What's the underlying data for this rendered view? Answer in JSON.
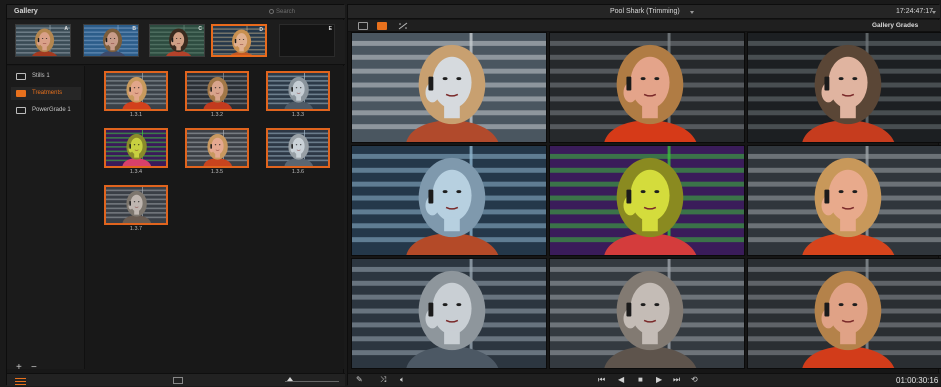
{
  "gallery": {
    "title": "Gallery",
    "search_placeholder": "Search",
    "memories": [
      {
        "letter": "A",
        "variant": 0
      },
      {
        "letter": "B",
        "variant": 1
      },
      {
        "letter": "C",
        "variant": 2
      },
      {
        "letter": "D",
        "variant": 3,
        "active": true
      },
      {
        "letter": "E",
        "empty": true
      }
    ],
    "albums": [
      {
        "label": "Stills 1",
        "icon": "stills-album-icon"
      },
      {
        "label": "Treatments",
        "icon": "treatments-album-icon",
        "selected": true
      },
      {
        "label": "PowerGrade 1",
        "icon": "powergrade-album-icon"
      }
    ],
    "stills": [
      {
        "label": "1.3.1",
        "variant": 4
      },
      {
        "label": "1.3.2",
        "variant": 5
      },
      {
        "label": "1.3.3",
        "variant": 6
      },
      {
        "label": "1.3.4",
        "variant": 7
      },
      {
        "label": "1.3.5",
        "variant": 8
      },
      {
        "label": "1.3.6",
        "variant": 9
      },
      {
        "label": "1.3.7",
        "variant": 10
      }
    ],
    "add_label": "+",
    "remove_label": "−"
  },
  "viewer": {
    "clip_title": "Pool Shark (Trimming)",
    "timecode_top": "17:24:47:17",
    "mode_label": "Gallery Grades",
    "timecode_bottom": "01:00:30:16",
    "grades": [
      {
        "variant": 11
      },
      {
        "variant": 12
      },
      {
        "variant": 13
      },
      {
        "variant": 14
      },
      {
        "variant": 15
      },
      {
        "variant": 16
      },
      {
        "variant": 17
      },
      {
        "variant": 18
      },
      {
        "variant": 19
      }
    ],
    "transport": {
      "first": "⏮",
      "prev": "◀",
      "stop": "■",
      "play": "▶",
      "last": "⏭",
      "loop": "⟲"
    }
  },
  "palettes": [
    {
      "bg": "#3a4b55",
      "stripe": "#9aa9b2",
      "skin": "#d9a088",
      "hair": "#b3864f",
      "coat": "#a33a20"
    },
    {
      "bg": "#2c5d8a",
      "stripe": "#7fa3c8",
      "skin": "#c89c8a",
      "hair": "#7a5d3c",
      "coat": "#3d4a6a"
    },
    {
      "bg": "#2d4c40",
      "stripe": "#6a8a7a",
      "skin": "#d0a085",
      "hair": "#3a2a1e",
      "coat": "#b4422a"
    },
    {
      "bg": "#26384a",
      "stripe": "#b7a789",
      "skin": "#e0b090",
      "hair": "#c89050",
      "coat": "#c45a25"
    },
    {
      "bg": "#3a4148",
      "stripe": "#9aa4ac",
      "skin": "#e2a68a",
      "hair": "#c89a5e",
      "coat": "#d2401c"
    },
    {
      "bg": "#2a2f35",
      "stripe": "#8d949a",
      "skin": "#d8a48c",
      "hair": "#a27848",
      "coat": "#c23a1e"
    },
    {
      "bg": "#2c3a48",
      "stripe": "#a4b8c6",
      "skin": "#c5cdd4",
      "hair": "#8a949c",
      "coat": "#4e5a66"
    },
    {
      "bg": "#3a1a5a",
      "stripe": "#3ec83e",
      "skin": "#c8d040",
      "hair": "#8a8a2a",
      "coat": "#d8406a"
    },
    {
      "bg": "#3c4046",
      "stripe": "#a8adb2",
      "skin": "#e4a890",
      "hair": "#c89860",
      "coat": "#c8441e"
    },
    {
      "bg": "#2d3846",
      "stripe": "#9fb4c4",
      "skin": "#cad2d8",
      "hair": "#98a0a6",
      "coat": "#5a6672"
    },
    {
      "bg": "#3a3f46",
      "stripe": "#a0a6ac",
      "skin": "#bfb6b0",
      "hair": "#7d766e",
      "coat": "#6a5c52"
    },
    {
      "bg": "#4a5660",
      "stripe": "#c6ccd0",
      "skin": "#d6dade",
      "hair": "#c8a070",
      "coat": "#b14a2c"
    },
    {
      "bg": "#26292c",
      "stripe": "#7c8287",
      "skin": "#e4a48a",
      "hair": "#b07c44",
      "coat": "#d63a18"
    },
    {
      "bg": "#1c1f22",
      "stripe": "#6e7478",
      "skin": "#e0b4a0",
      "hair": "#5a4636",
      "coat": "#c63c1e"
    },
    {
      "bg": "#24384a",
      "stripe": "#8fb6d0",
      "skin": "#b7d0e0",
      "hair": "#7f99ad",
      "coat": "#b44a28"
    },
    {
      "bg": "#3a1c5a",
      "stripe": "#3cbc3c",
      "skin": "#d4dc3c",
      "hair": "#8a8a20",
      "coat": "#d43c3c"
    },
    {
      "bg": "#30363c",
      "stripe": "#9ea4a8",
      "skin": "#e8aa8c",
      "hair": "#c8985a",
      "coat": "#d6441c"
    },
    {
      "bg": "#2c3640",
      "stripe": "#9aa8b2",
      "skin": "#c9cfd4",
      "hair": "#8e969c",
      "coat": "#4c5864"
    },
    {
      "bg": "#343a40",
      "stripe": "#9ea4aa",
      "skin": "#c4bcb6",
      "hair": "#827a72",
      "coat": "#5e544c"
    },
    {
      "bg": "#2a2e32",
      "stripe": "#8a9095",
      "skin": "#e0a286",
      "hair": "#b4824a",
      "coat": "#d23c1a"
    }
  ]
}
